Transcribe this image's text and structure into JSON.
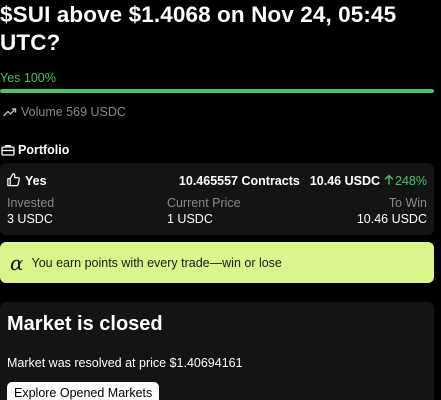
{
  "market": {
    "title": "$SUI above $1.4068 on Nov 24, 05:45 UTC?"
  },
  "outcome": {
    "label": "Yes 100%",
    "progress_fraction": 1.0,
    "color": "#4ac26b"
  },
  "volume": {
    "icon": "trending-up-icon",
    "text": "Volume 569 USDC"
  },
  "portfolio": {
    "icon": "briefcase-icon",
    "heading": "Portfolio",
    "position": {
      "side_icon": "thumbs-up-icon",
      "side": "Yes",
      "contracts": "10.465557 Contracts",
      "value": "10.46 USDC",
      "change": "248%",
      "change_icon": "arrow-up-icon",
      "stats": [
        {
          "label": "Invested",
          "value": "3 USDC"
        },
        {
          "label": "Current Price",
          "value": "1 USDC"
        },
        {
          "label": "To Win",
          "value": "10.46 USDC"
        }
      ]
    }
  },
  "points_banner": {
    "icon": "alpha-icon",
    "symbol": "α",
    "text": "You earn points with every trade—win or lose",
    "bg_color": "#d9f58c"
  },
  "closed": {
    "title": "Market is closed",
    "resolved_text": "Market was resolved at price $1.40694161",
    "button_label": "Explore Opened Markets"
  }
}
